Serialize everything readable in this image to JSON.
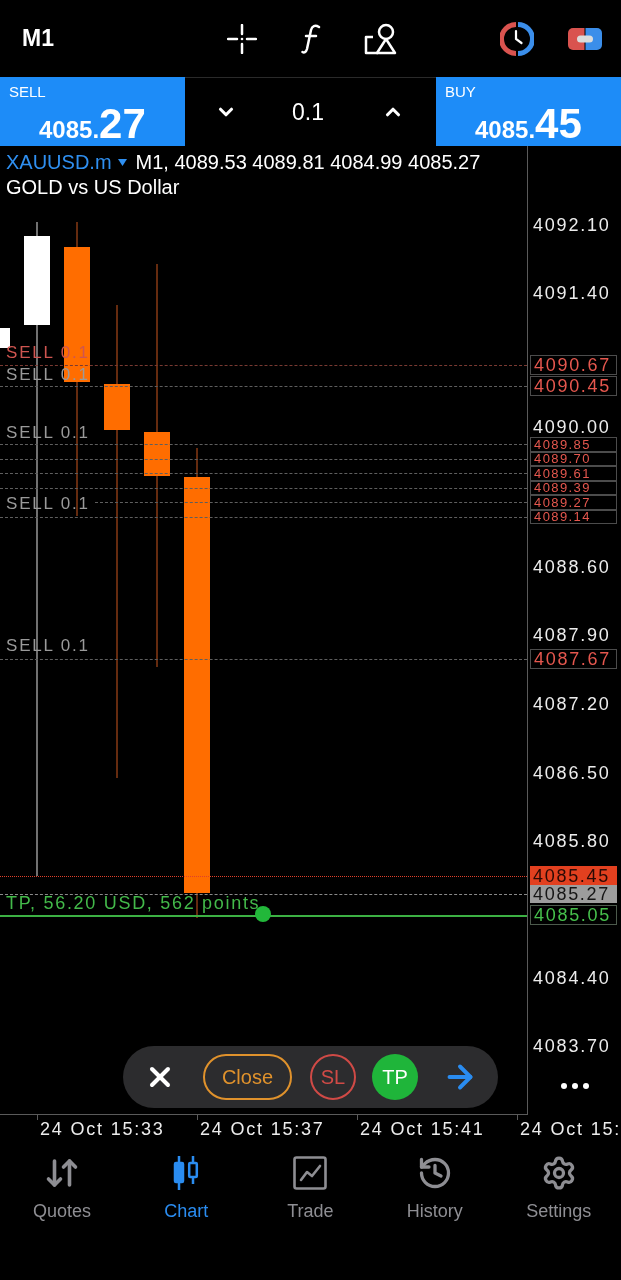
{
  "top_bar": {
    "timeframe": "M1"
  },
  "trade_panel": {
    "sell": {
      "label": "SELL",
      "price_main": "4085.",
      "price_pips": "27"
    },
    "volume": "0.1",
    "buy": {
      "label": "BUY",
      "price_main": "4085.",
      "price_pips": "45"
    }
  },
  "chart": {
    "symbol": "XAUUSD.m",
    "info": "M1, 4089.53 4089.81 4084.99 4085.27",
    "description": "GOLD vs US Dollar",
    "price_ticks": [
      "4092.10",
      "4091.40",
      "4090.00",
      "4088.60",
      "4087.90",
      "4087.20",
      "4086.50",
      "4085.80",
      "4084.40",
      "4083.70"
    ],
    "order_labels": [
      {
        "text": "SELL 0.1",
        "color": "#cf5550"
      },
      {
        "text": "SELL 0.1",
        "color": "#9a9a9a"
      },
      {
        "text": "SELL 0.1",
        "color": "#9a9a9a"
      },
      {
        "text": "SELL 0.1",
        "color": "#9a9a9a"
      },
      {
        "text": "SELL 0.1",
        "color": "#9a9a9a"
      }
    ],
    "price_tags": [
      {
        "kind": "order",
        "text": "4090.67"
      },
      {
        "kind": "order",
        "text": "4090.45"
      },
      {
        "kind": "order",
        "text": "4089.85"
      },
      {
        "kind": "order",
        "text": "4089.70"
      },
      {
        "kind": "order",
        "text": "4089.61"
      },
      {
        "kind": "order",
        "text": "4089.39"
      },
      {
        "kind": "order",
        "text": "4089.27"
      },
      {
        "kind": "order",
        "text": "4089.14"
      },
      {
        "kind": "order",
        "text": "4087.67"
      },
      {
        "kind": "ask",
        "text": "4085.45"
      },
      {
        "kind": "bid",
        "text": "4085.27"
      },
      {
        "kind": "take_profit",
        "text": "4085.05"
      }
    ],
    "take_profit_label": "TP, 56.20 USD, 562 points",
    "time_labels": [
      "24 Oct 15:33",
      "24 Oct 15:37",
      "24 Oct 15:41",
      "24 Oct 15:"
    ]
  },
  "order_toolbar": {
    "close": "Close",
    "stop_loss": "SL",
    "take_profit": "TP"
  },
  "nav": [
    {
      "label": "Quotes",
      "selected": false
    },
    {
      "label": "Chart",
      "selected": true
    },
    {
      "label": "Trade",
      "selected": false
    },
    {
      "label": "History",
      "selected": false
    },
    {
      "label": "Settings",
      "selected": false
    }
  ]
}
